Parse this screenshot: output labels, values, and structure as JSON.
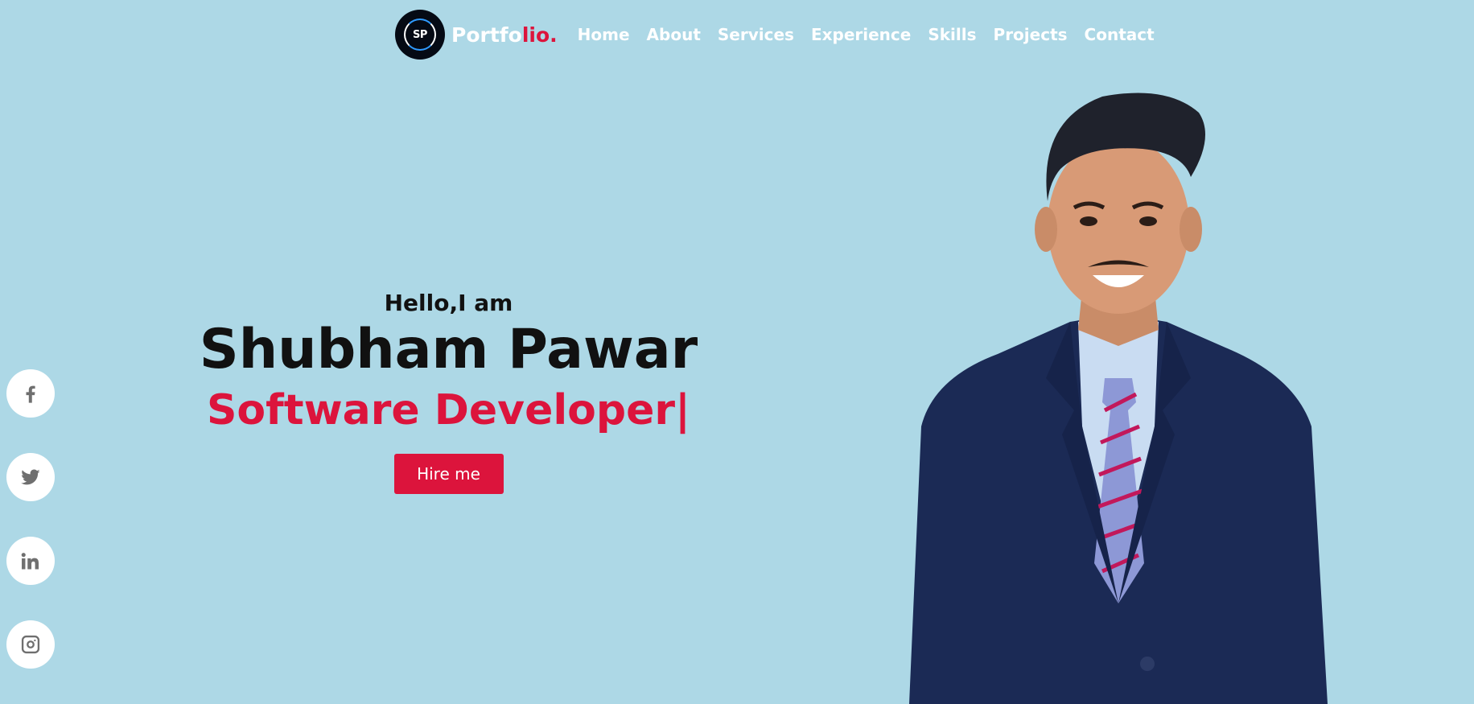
{
  "brand": {
    "logo_initials": "SP",
    "name_main": "Portfo",
    "name_accent": "lio."
  },
  "nav": {
    "items": [
      "Home",
      "About",
      "Services",
      "Experience",
      "Skills",
      "Projects",
      "Contact"
    ]
  },
  "hero": {
    "greeting": "Hello,I am",
    "name": "Shubham Pawar",
    "role": "Software Developer",
    "cursor": "|",
    "cta_label": "Hire me"
  },
  "social": {
    "icons": [
      "facebook-icon",
      "twitter-icon",
      "linkedin-icon",
      "instagram-icon"
    ]
  },
  "colors": {
    "background": "#add8e6",
    "accent": "#dc143c",
    "text": "#111111",
    "nav_text": "#ffffff"
  }
}
